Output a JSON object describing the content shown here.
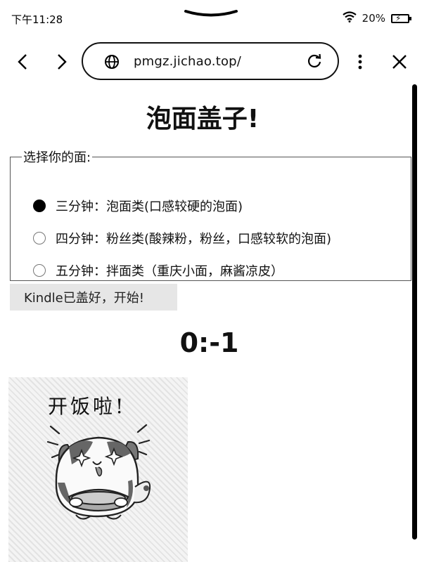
{
  "status": {
    "time": "下午11:28",
    "battery": "20%"
  },
  "browser": {
    "url": "pmgz.jichao.top/"
  },
  "page": {
    "title": "泡面盖子!",
    "legend": "选择你的面:",
    "options": [
      {
        "label": "三分钟：泡面类(口感较硬的泡面)",
        "selected": true
      },
      {
        "label": "四分钟：粉丝类(酸辣粉，粉丝，口感较软的泡面)",
        "selected": false
      },
      {
        "label": "五分钟：拌面类（重庆小面，麻酱凉皮）",
        "selected": false
      }
    ],
    "start_button": "Kindle已盖好，开始!",
    "timer": "0:-1",
    "sticker_text": "开饭啦!"
  },
  "icons": {
    "pulldown": "chevron-down-icon",
    "wifi": "wifi-icon",
    "battery": "battery-charging-icon",
    "back": "chevron-left-icon",
    "forward": "chevron-right-icon",
    "globe": "globe-icon",
    "reload": "reload-icon",
    "menu": "more-vertical-icon",
    "close": "close-icon"
  }
}
